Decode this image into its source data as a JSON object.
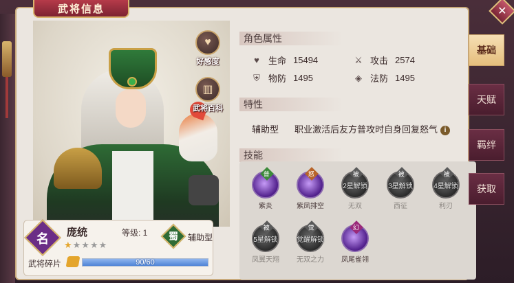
{
  "window": {
    "title": "武将信息",
    "close_label": "✕"
  },
  "hero_art": {
    "buttons": [
      {
        "label": "好感度",
        "icon": "heart-icon"
      },
      {
        "label": "武将百科",
        "icon": "book-icon"
      }
    ]
  },
  "hero_card": {
    "name_badge": "名",
    "name": "庞统",
    "level_label": "等级: 1",
    "stars_filled": 1,
    "stars_total": 5,
    "faction": "蜀",
    "type": "辅助型",
    "shard_label": "武将碎片",
    "shard_text": "90/60",
    "shard_progress": 1.0
  },
  "attributes": {
    "heading": "角色属性",
    "items": [
      {
        "icon": "heart-icon",
        "label": "生命",
        "value": "15494"
      },
      {
        "icon": "sword-icon",
        "label": "攻击",
        "value": "2574"
      },
      {
        "icon": "shield-icon",
        "label": "物防",
        "value": "1495"
      },
      {
        "icon": "magic-shield-icon",
        "label": "法防",
        "value": "1495"
      }
    ]
  },
  "trait": {
    "heading": "特性",
    "type": "辅助型",
    "description": "职业激活后友方普攻时自身回复怒气",
    "info_icon": "i"
  },
  "skills": {
    "heading": "技能",
    "items": [
      {
        "name": "紫炎",
        "tag": "普",
        "tag_color": "green",
        "orb": "purple",
        "lock": ""
      },
      {
        "name": "紫凤排空",
        "tag": "怒",
        "tag_color": "orange",
        "orb": "purple",
        "lock": ""
      },
      {
        "name": "无双",
        "tag": "被",
        "tag_color": "grey",
        "orb": "dark",
        "lock": "2星解锁"
      },
      {
        "name": "西征",
        "tag": "被",
        "tag_color": "grey",
        "orb": "dark",
        "lock": "3星解锁"
      },
      {
        "name": "利刃",
        "tag": "被",
        "tag_color": "grey",
        "orb": "dark",
        "lock": "4星解锁"
      },
      {
        "name": "凤翼天翔",
        "tag": "被",
        "tag_color": "grey",
        "orb": "dark",
        "lock": "5星解锁"
      },
      {
        "name": "无双之力",
        "tag": "觉",
        "tag_color": "grey",
        "orb": "dark",
        "lock": "觉醒解锁"
      },
      {
        "name": "凤尾雀翎",
        "tag": "幻",
        "tag_color": "magenta",
        "orb": "purple",
        "lock": ""
      }
    ]
  },
  "tabs": [
    {
      "label": "基础",
      "active": true
    },
    {
      "label": "天赋",
      "active": false
    },
    {
      "label": "羁绊",
      "active": false
    },
    {
      "label": "获取",
      "active": false
    }
  ]
}
